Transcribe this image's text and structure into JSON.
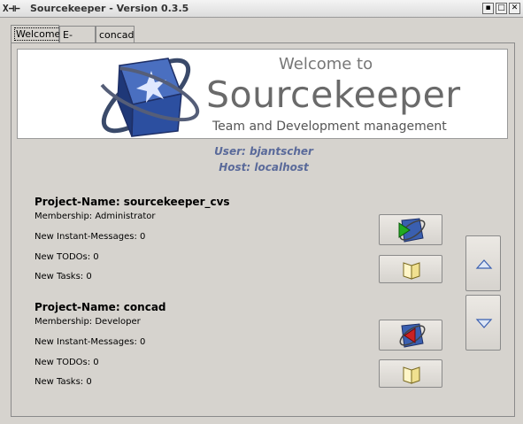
{
  "window": {
    "title": "Sourcekeeper - Version 0.3.5",
    "controls": [
      "minimize",
      "maximize",
      "close"
    ]
  },
  "tabs": [
    {
      "label": "Welcome",
      "active": true
    },
    {
      "label": "E-Mail",
      "active": false
    },
    {
      "label": "concad",
      "active": false
    }
  ],
  "banner": {
    "welcome_to": "Welcome to",
    "product": "Sourcekeeper",
    "tagline": "Team and Development management"
  },
  "session": {
    "user": "User: bjantscher",
    "host": "Host: localhost"
  },
  "projects": [
    {
      "name": "Project-Name: sourcekeeper_cvs",
      "membership": "Membership: Administrator",
      "messages": "New Instant-Messages: 0",
      "todos": "New TODOs: 0",
      "tasks": "New Tasks: 0",
      "action_icon": "cube-green-arrow-icon",
      "book_icon": "book-icon"
    },
    {
      "name": "Project-Name: concad",
      "membership": "Membership: Developer",
      "messages": "New Instant-Messages: 0",
      "todos": "New TODOs: 0",
      "tasks": "New Tasks: 0",
      "action_icon": "cube-red-arrow-icon",
      "book_icon": "book-icon"
    }
  ],
  "scroll": {
    "up_icon": "triangle-up-icon",
    "down_icon": "triangle-down-icon"
  },
  "colors": {
    "background": "#d6d3ce",
    "session_text": "#5a6a9a",
    "logo_blue": "#2c4fa0"
  }
}
